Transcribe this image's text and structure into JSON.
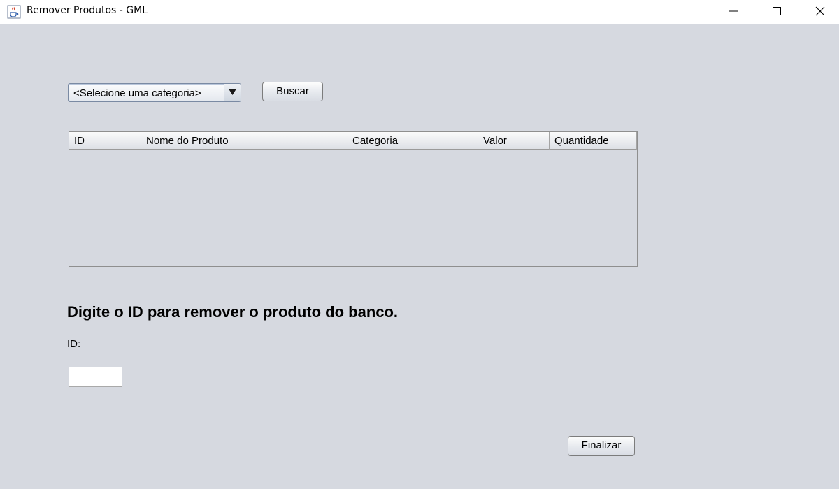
{
  "window": {
    "title": "Remover Produtos - GML",
    "icon": "java-cup-icon"
  },
  "filter": {
    "category_selected": "<Selecione uma categoria>",
    "search_label": "Buscar"
  },
  "table": {
    "columns": [
      "ID",
      "Nome do Produto",
      "Categoria",
      "Valor",
      "Quantidade"
    ],
    "rows": []
  },
  "remove": {
    "heading": "Digite o ID para remover o produto do banco.",
    "id_label": "ID:",
    "id_value": ""
  },
  "footer": {
    "finish_label": "Finalizar"
  }
}
